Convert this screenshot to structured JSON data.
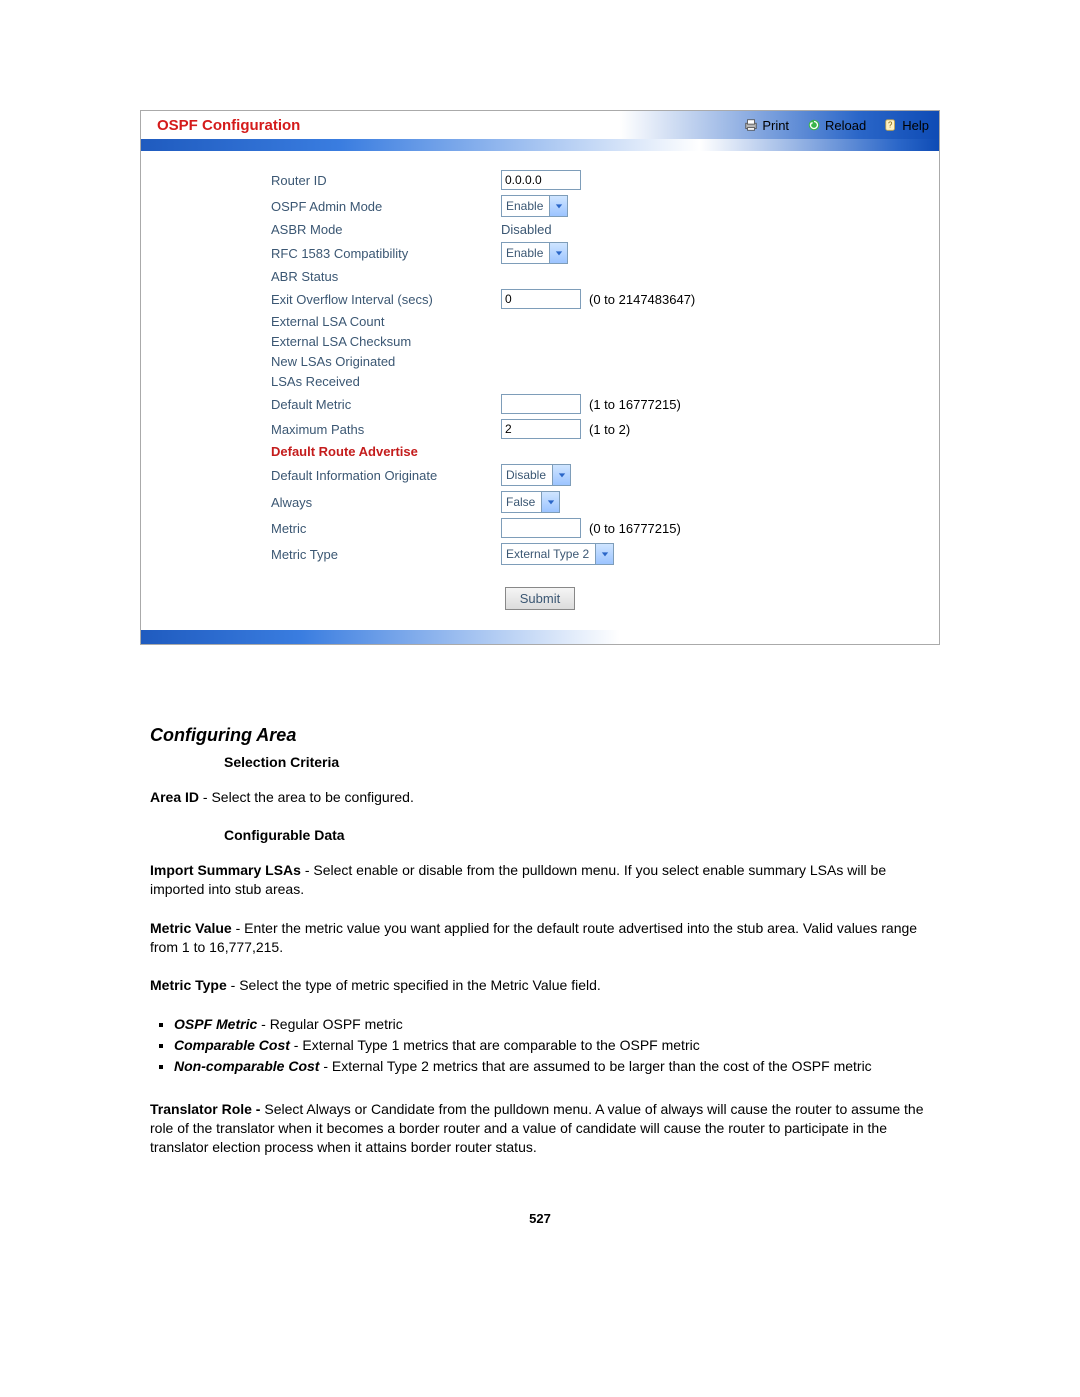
{
  "screenshot": {
    "title": "OSPF Configuration",
    "actions": {
      "print": "Print",
      "reload": "Reload",
      "help": "Help"
    },
    "rows": {
      "router_id": {
        "label": "Router ID",
        "value": "0.0.0.0"
      },
      "ospf_admin_mode": {
        "label": "OSPF Admin Mode",
        "value": "Enable"
      },
      "asbr_mode": {
        "label": "ASBR Mode",
        "value": "Disabled"
      },
      "rfc1583": {
        "label": "RFC 1583 Compatibility",
        "value": "Enable"
      },
      "abr_status": {
        "label": "ABR Status"
      },
      "exit_overflow": {
        "label": "Exit Overflow Interval (secs)",
        "value": "0",
        "hint": "(0 to 2147483647)"
      },
      "ext_lsa_count": {
        "label": "External LSA Count"
      },
      "ext_lsa_checksum": {
        "label": "External LSA Checksum"
      },
      "new_lsas": {
        "label": "New LSAs Originated"
      },
      "lsas_received": {
        "label": "LSAs Received"
      },
      "default_metric": {
        "label": "Default Metric",
        "value": "",
        "hint": "(1 to 16777215)"
      },
      "max_paths": {
        "label": "Maximum Paths",
        "value": "2",
        "hint": "(1 to 2)"
      },
      "section_dra": "Default Route Advertise",
      "dio": {
        "label": "Default Information Originate",
        "value": "Disable"
      },
      "always": {
        "label": "Always",
        "value": "False"
      },
      "metric": {
        "label": "Metric",
        "value": "",
        "hint": "(0 to 16777215)"
      },
      "metric_type": {
        "label": "Metric Type",
        "value": "External Type 2"
      }
    },
    "submit": "Submit"
  },
  "doc": {
    "heading": "Configuring Area",
    "sub1": "Selection Criteria",
    "area_id_b": "Area ID",
    "area_id_rest": " - Select the area to be configured.",
    "sub2": "Configurable Data",
    "import_b": "Import Summary LSAs",
    "import_rest": " - Select enable or disable from the pulldown menu. If you select enable summary LSAs will be imported into stub areas.",
    "metric_value_b": "Metric Value",
    "metric_value_rest": " - Enter the metric value you want applied for the default route advertised into the stub area. Valid values range from 1 to 16,777,215.",
    "metric_type_b": "Metric Type",
    "metric_type_rest": " - Select the type of metric specified in the Metric Value field.",
    "li1_b": "OSPF Metric",
    "li1_rest": " - Regular OSPF metric",
    "li2_b": "Comparable Cost",
    "li2_rest": " - External Type 1 metrics that are comparable to the OSPF metric",
    "li3_b": "Non-comparable Cost",
    "li3_rest": " - External Type 2 metrics that are assumed to be larger than the cost of the OSPF metric",
    "translator_b": "Translator Role - ",
    "translator_rest": "Select Always or Candidate from the pulldown menu. A value of always will cause the router to assume the role of the translator when it becomes a border router and a value of candidate will cause the router to participate in the translator election process when it attains border router status.",
    "page_number": "527"
  }
}
